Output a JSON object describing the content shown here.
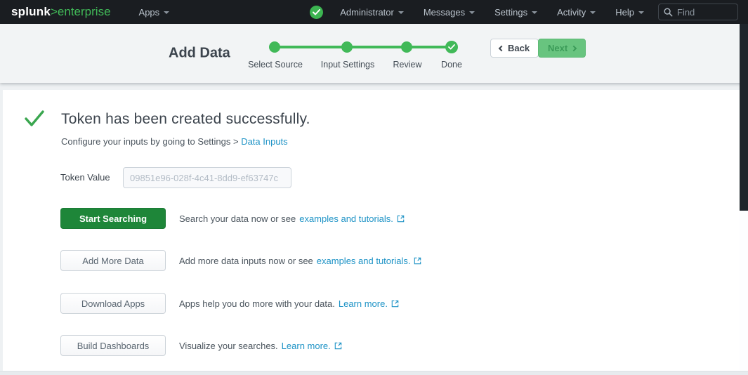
{
  "nav": {
    "logo_brand": "splunk",
    "logo_suffix": ">enterprise",
    "apps_label": "Apps",
    "status_icon": "check-circle",
    "items": [
      "Administrator",
      "Messages",
      "Settings",
      "Activity",
      "Help"
    ],
    "find_placeholder": "Find"
  },
  "header": {
    "title": "Add Data",
    "steps": [
      {
        "label": "Select Source",
        "state": "complete"
      },
      {
        "label": "Input Settings",
        "state": "complete"
      },
      {
        "label": "Review",
        "state": "complete"
      },
      {
        "label": "Done",
        "state": "complete-check"
      }
    ],
    "back_label": "Back",
    "next_label": "Next"
  },
  "main": {
    "heading": "Token has been created successfully.",
    "subtext_prefix": "Configure your inputs by going to Settings > ",
    "subtext_link": "Data Inputs",
    "token_label": "Token Value",
    "token_value": "09851e96-028f-4c41-8dd9-ef63747c",
    "actions": [
      {
        "button": "Start Searching",
        "desc": "Search your data now or see ",
        "link": "examples and tutorials."
      },
      {
        "button": "Add More Data",
        "desc": "Add more data inputs now or see ",
        "link": "examples and tutorials."
      },
      {
        "button": "Download Apps",
        "desc": "Apps help you do more with your data. ",
        "link": "Learn more."
      },
      {
        "button": "Build Dashboards",
        "desc": "Visualize your searches. ",
        "link": "Learn more."
      }
    ]
  },
  "colors": {
    "nav_bg": "#1a1d21",
    "accent_green": "#41b958",
    "primary_button_green": "#1e8639",
    "link_blue": "#1e93c6",
    "header_band_bg": "#f2f4f5"
  }
}
